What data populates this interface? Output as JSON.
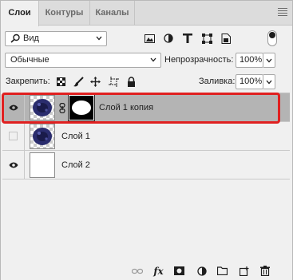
{
  "tabs": [
    {
      "label": "Слои"
    },
    {
      "label": "Контуры"
    },
    {
      "label": "Каналы"
    }
  ],
  "filter": {
    "kind_label": "Вид",
    "toggle_state": "on"
  },
  "blend": {
    "mode": "Обычные",
    "opacity_label": "Непрозрачность:",
    "opacity_value": "100%"
  },
  "lock": {
    "label": "Закрепить:",
    "fill_label": "Заливка:",
    "fill_value": "100%"
  },
  "layers": [
    {
      "name": "Слой 1 копия",
      "visible": true,
      "selected": true,
      "has_mask": true
    },
    {
      "name": "Слой 1",
      "visible": false,
      "selected": false,
      "has_mask": false
    },
    {
      "name": "Слой 2",
      "visible": true,
      "selected": false,
      "has_mask": false
    }
  ],
  "bottom_toolbar": {
    "fx_label": "fx"
  },
  "colors": {
    "accent_highlight": "#e02020",
    "selected_row": "#b4b4b4",
    "panel_bg": "#f0f0f0"
  }
}
